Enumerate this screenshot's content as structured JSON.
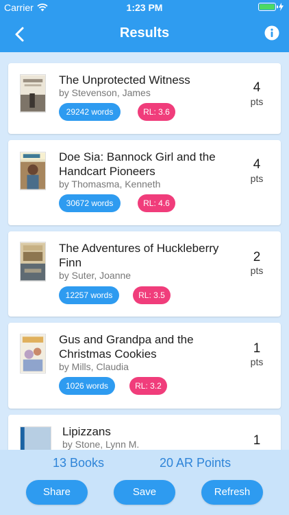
{
  "status_bar": {
    "carrier": "Carrier",
    "time": "1:23 PM"
  },
  "nav": {
    "title": "Results"
  },
  "books": [
    {
      "title": "The Unprotected Witness",
      "author": "by Stevenson, James",
      "words": "29242 words",
      "rl": "RL: 3.6",
      "pts": "4",
      "pts_label": "pts"
    },
    {
      "title": "Doe Sia: Bannock Girl and the Handcart Pioneers",
      "author": "by Thomasma, Kenneth",
      "words": "30672 words",
      "rl": "RL: 4.6",
      "pts": "4",
      "pts_label": "pts"
    },
    {
      "title": "The Adventures of Huckleberry Finn",
      "author": "by Suter, Joanne",
      "words": "12257 words",
      "rl": "RL: 3.5",
      "pts": "2",
      "pts_label": "pts"
    },
    {
      "title": "Gus and Grandpa and the Christmas Cookies",
      "author": "by Mills, Claudia",
      "words": "1026 words",
      "rl": "RL: 3.2",
      "pts": "1",
      "pts_label": "pts"
    },
    {
      "title": "Lipizzans",
      "author": "by Stone, Lynn M.",
      "pts": "1"
    }
  ],
  "summary": {
    "books": "13 Books",
    "points": "20 AR Points"
  },
  "buttons": {
    "share": "Share",
    "save": "Save",
    "refresh": "Refresh"
  },
  "colors": {
    "primary": "#2f9cf0",
    "pill_words": "#2e9bf0",
    "pill_rl": "#f03d7b",
    "list_bg": "#d6e9fb"
  },
  "icons": {
    "back": "chevron-left-icon",
    "info": "info-icon",
    "wifi": "wifi-icon",
    "battery": "battery-icon"
  }
}
